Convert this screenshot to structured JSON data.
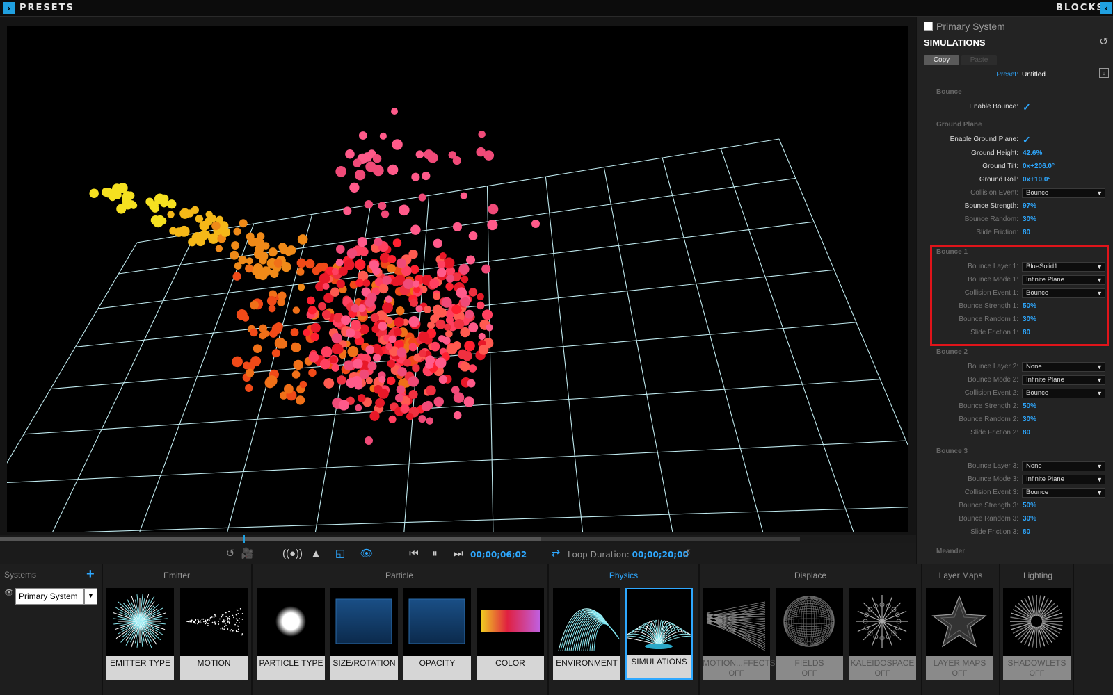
{
  "topbar": {
    "left_title": "PRESETS",
    "right_title": "BLOCKS",
    "left_toggle_icon": "chevron-right-icon",
    "right_toggle_icon": "chevron-left-icon"
  },
  "transport": {
    "current_time": "00;00;06;02",
    "loop_label": "Loop Duration:",
    "loop_duration": "00;00;20;00"
  },
  "panel": {
    "system_name": "Primary System",
    "section_title": "SIMULATIONS",
    "copy_label": "Copy",
    "paste_label": "Paste",
    "preset_label": "Preset:",
    "preset_value": "Untitled",
    "sections": {
      "bounce": "Bounce",
      "ground_plane": "Ground Plane",
      "bounce1": "Bounce 1",
      "bounce2": "Bounce 2",
      "bounce3": "Bounce 3",
      "meander": "Meander"
    },
    "enable_bounce": {
      "label": "Enable Bounce:",
      "value": "✓"
    },
    "enable_ground_plane": {
      "label": "Enable Ground Plane:",
      "value": "✓"
    },
    "ground_height": {
      "label": "Ground Height:",
      "value": "42.6%"
    },
    "ground_tilt": {
      "label": "Ground Tilt:",
      "value": "0x+206.0°"
    },
    "ground_roll": {
      "label": "Ground Roll:",
      "value": "0x+10.0°"
    },
    "collision_event": {
      "label": "Collision Event:",
      "value": "Bounce"
    },
    "bounce_strength": {
      "label": "Bounce Strength:",
      "value": "97%"
    },
    "bounce_random": {
      "label": "Bounce Random:",
      "value": "30%"
    },
    "slide_friction": {
      "label": "Slide Friction:",
      "value": "80"
    },
    "b1": {
      "layer": {
        "label": "Bounce Layer 1:",
        "value": "BlueSolid1"
      },
      "mode": {
        "label": "Bounce Mode 1:",
        "value": "Infinite Plane"
      },
      "collision": {
        "label": "Collision Event 1:",
        "value": "Bounce"
      },
      "strength": {
        "label": "Bounce Strength 1:",
        "value": "50%"
      },
      "random": {
        "label": "Bounce Random 1:",
        "value": "30%"
      },
      "friction": {
        "label": "Slide Friction 1:",
        "value": "80"
      }
    },
    "b2": {
      "layer": {
        "label": "Bounce Layer 2:",
        "value": "None"
      },
      "mode": {
        "label": "Bounce Mode 2:",
        "value": "Infinite Plane"
      },
      "collision": {
        "label": "Collision Event 2:",
        "value": "Bounce"
      },
      "strength": {
        "label": "Bounce Strength 2:",
        "value": "50%"
      },
      "random": {
        "label": "Bounce Random 2:",
        "value": "30%"
      },
      "friction": {
        "label": "Slide Friction 2:",
        "value": "80"
      }
    },
    "b3": {
      "layer": {
        "label": "Bounce Layer 3:",
        "value": "None"
      },
      "mode": {
        "label": "Bounce Mode 3:",
        "value": "Infinite Plane"
      },
      "collision": {
        "label": "Collision Event 3:",
        "value": "Bounce"
      },
      "strength": {
        "label": "Bounce Strength 3:",
        "value": "50%"
      },
      "random": {
        "label": "Bounce Random 3:",
        "value": "30%"
      },
      "friction": {
        "label": "Slide Friction 3:",
        "value": "80"
      }
    }
  },
  "systems": {
    "header": "Systems",
    "selected": "Primary System"
  },
  "categories": {
    "emitter": "Emitter",
    "particle": "Particle",
    "physics": "Physics",
    "displace": "Displace",
    "layer_maps": "Layer Maps",
    "lighting": "Lighting"
  },
  "tiles": {
    "emitter_type": "EMITTER TYPE",
    "motion": "MOTION",
    "particle_type": "PARTICLE TYPE",
    "size_rotation": "SIZE/ROTATION",
    "opacity": "OPACITY",
    "color": "COLOR",
    "environment": "ENVIRONMENT",
    "simulations": "SIMULATIONS",
    "motion_effects": "MOTION...FFECTS",
    "fields": "FIELDS",
    "kaleidospace": "KALEIDOSPACE",
    "layer_maps": "LAYER MAPS",
    "shadowlets": "SHADOWLETS",
    "off": "OFF"
  }
}
